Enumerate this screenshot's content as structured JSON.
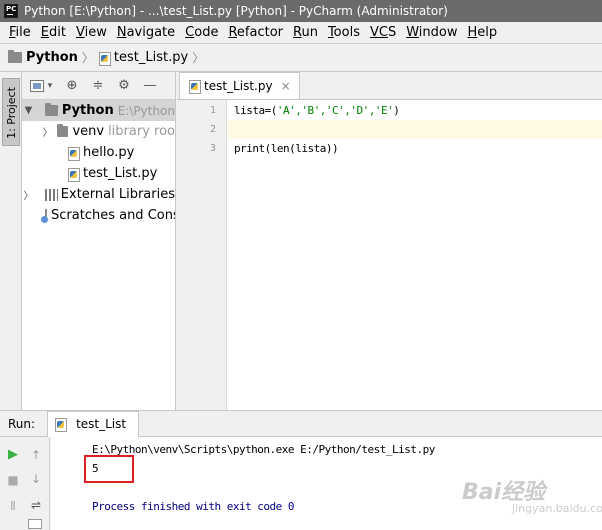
{
  "window": {
    "title": "Python [E:\\Python] - ...\\test_List.py [Python] - PyCharm (Administrator)"
  },
  "menu": [
    {
      "key": "F",
      "rest": "ile"
    },
    {
      "key": "E",
      "rest": "dit"
    },
    {
      "key": "V",
      "rest": "iew"
    },
    {
      "key": "N",
      "rest": "avigate"
    },
    {
      "key": "C",
      "rest": "ode"
    },
    {
      "key": "R",
      "rest": "efactor"
    },
    {
      "key": "R",
      "rest": "un"
    },
    {
      "key": "T",
      "rest": "ools"
    },
    {
      "key": "VC",
      "rest": "S"
    },
    {
      "key": "W",
      "rest": "indow"
    },
    {
      "key": "H",
      "rest": "elp"
    }
  ],
  "breadcrumb": {
    "project": "Python",
    "file": "test_List.py"
  },
  "tool_stripe": {
    "project_tab": "1: Project"
  },
  "project_tree": {
    "root": {
      "name": "Python",
      "path": "E:\\Python"
    },
    "venv": {
      "name": "venv",
      "note": "library roo"
    },
    "files": [
      "hello.py",
      "test_List.py"
    ],
    "external_libraries": "External Libraries",
    "scratches": "Scratches and Cons"
  },
  "editor": {
    "tab": "test_List.py",
    "line_numbers": [
      "1",
      "2",
      "3"
    ],
    "code": {
      "line1_var": "lista=(",
      "line1_str": "'A','B','C','D','E'",
      "line1_end": ")",
      "line3": "print(len(lista))"
    }
  },
  "run": {
    "label": "Run:",
    "tab": "test_List",
    "command": "E:\\Python\\venv\\Scripts\\python.exe E:/Python/test_List.py",
    "output": "5",
    "exit_message": "Process finished with exit code 0"
  },
  "watermark": {
    "text": "Bai经验",
    "sub": "jingyan.baidu.com"
  },
  "colors": {
    "titlebar": "#6b6b6b",
    "highlight_box": "#e02020",
    "run_green": "#3cb043",
    "string": "#008000"
  }
}
